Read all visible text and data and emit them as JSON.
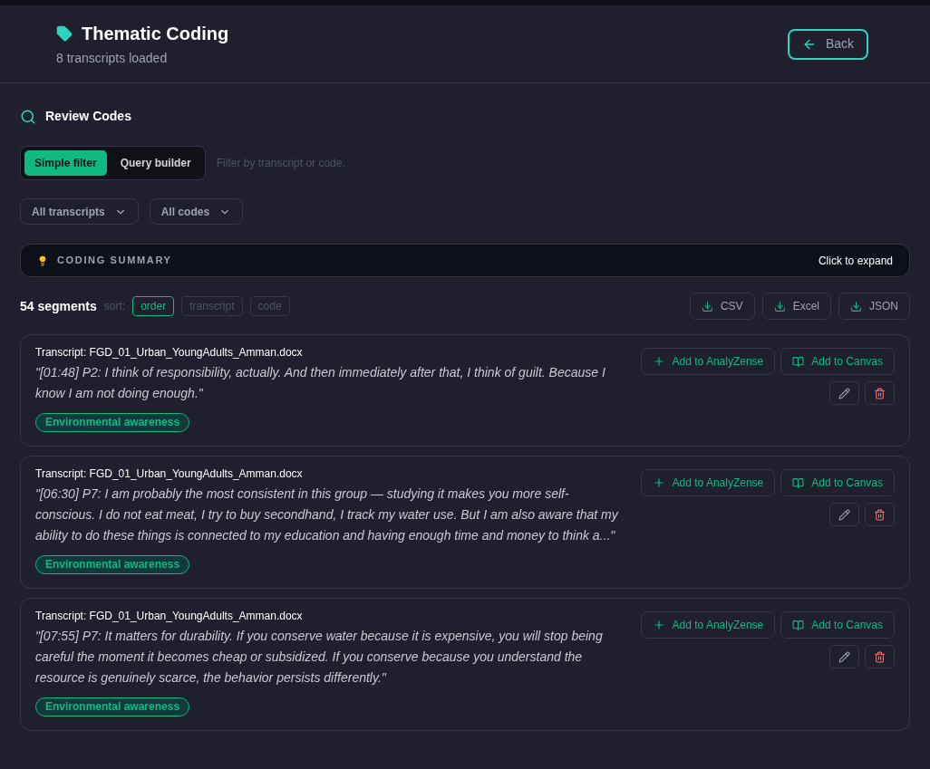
{
  "header": {
    "title": "Thematic Coding",
    "subtitle": "8 transcripts loaded",
    "back_button": "Back"
  },
  "review": {
    "title": "Review Codes",
    "filter_modes": [
      {
        "label": "Simple filter",
        "selected": true
      },
      {
        "label": "Query builder",
        "selected": false
      }
    ],
    "filter_hint": "Filter by transcript or code.",
    "dropdowns": [
      "All transcripts",
      "All codes"
    ]
  },
  "summary": {
    "title": "CODING SUMMARY",
    "action": "Click to expand"
  },
  "segments": {
    "count": "54 segments",
    "sort_label": "sort:",
    "sort_options": [
      {
        "label": "order",
        "selected": true
      },
      {
        "label": "transcript",
        "selected": false
      },
      {
        "label": "code",
        "selected": false
      }
    ],
    "exports": [
      "CSV",
      "Excel",
      "JSON"
    ],
    "items": [
      {
        "transcript": "Transcript: FGD_01_Urban_YoungAdults_Amman.docx",
        "quote": "\"[01:48] P2: I think of responsibility, actually. And then immediately after that, I think of guilt. Because I know I am not doing enough.\"",
        "code": "Environmental awareness",
        "add_button": "Add to AnalyZense",
        "canvas_button": "Add to Canvas"
      },
      {
        "transcript": "Transcript: FGD_01_Urban_YoungAdults_Amman.docx",
        "quote": "\"[06:30] P7: I am probably the most consistent in this group — studying it makes you more self-conscious. I do not eat meat, I try to buy secondhand, I track my water use. But I am also aware that my ability to do these things is connected to my education and having enough time and money to think a...\"",
        "code": "Environmental awareness",
        "add_button": "Add to AnalyZense",
        "canvas_button": "Add to Canvas"
      },
      {
        "transcript": "Transcript: FGD_01_Urban_YoungAdults_Amman.docx",
        "quote": "\"[07:55] P7: It matters for durability. If you conserve water because it is expensive, you will stop being careful the moment it becomes cheap or subsidized. If you conserve because you understand the resource is genuinely scarce, the behavior persists differently.\"",
        "code": "Environmental awareness",
        "add_button": "Add to AnalyZense",
        "canvas_button": "Add to Canvas"
      }
    ]
  }
}
